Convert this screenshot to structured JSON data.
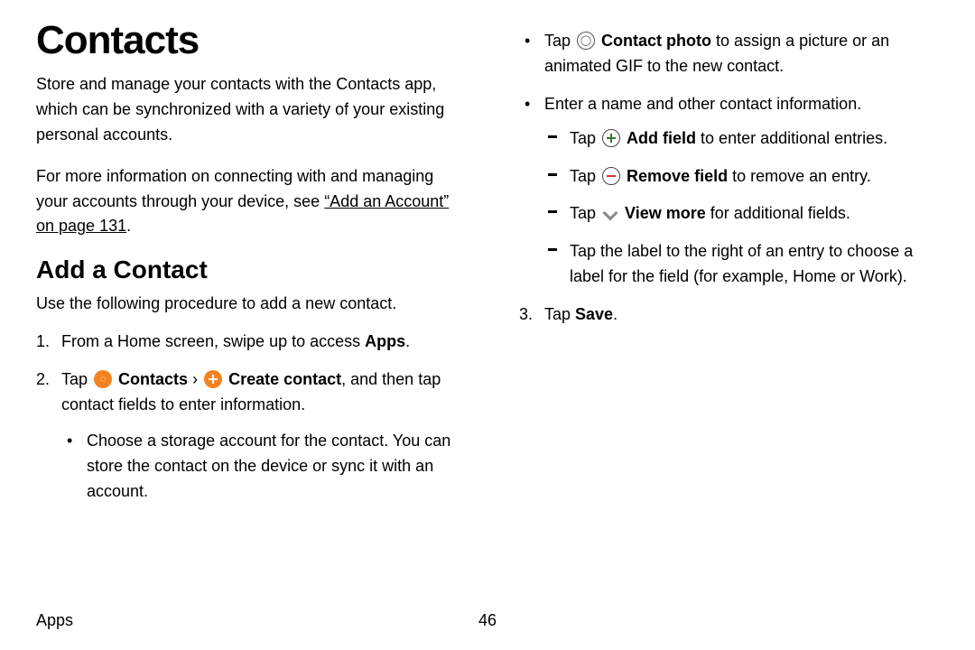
{
  "title": "Contacts",
  "intro1": "Store and manage your contacts with the Contacts app, which can be synchronized with a variety of your existing personal accounts.",
  "intro2a": "For more information on connecting with and managing your accounts through your device, see ",
  "intro2_link": "“Add an Account” on page 131",
  "intro2b": ".",
  "h2": "Add a Contact",
  "lead": "Use the following procedure to add a new contact.",
  "step1_a": "From a Home screen, swipe up to access ",
  "step1_b": "Apps",
  "step1_c": ".",
  "step2_a": "Tap ",
  "step2_b": "Contacts",
  "step2_c": " › ",
  "step2_d": "Create contact",
  "step2_e": ", and then tap contact fields to enter information.",
  "step2_bullet1": "Choose a storage account for the contact. You can store the contact on the device or sync it with an account.",
  "r_bullet1_a": "Tap ",
  "r_bullet1_b": "Contact photo",
  "r_bullet1_c": " to assign a picture or an animated GIF to the new contact.",
  "r_bullet2": "Enter a name and other contact information.",
  "r_dash1_a": "Tap ",
  "r_dash1_b": "Add field",
  "r_dash1_c": " to enter additional entries.",
  "r_dash2_a": "Tap ",
  "r_dash2_b": "Remove field",
  "r_dash2_c": " to remove an entry.",
  "r_dash3_a": "Tap ",
  "r_dash3_b": "View more",
  "r_dash3_c": " for additional fields.",
  "r_dash4": "Tap the label to the right of an entry to choose a label for the field (for example, Home or Work).",
  "step3_a": "Tap ",
  "step3_b": "Save",
  "step3_c": ".",
  "footer_section": "Apps",
  "footer_page": "46"
}
